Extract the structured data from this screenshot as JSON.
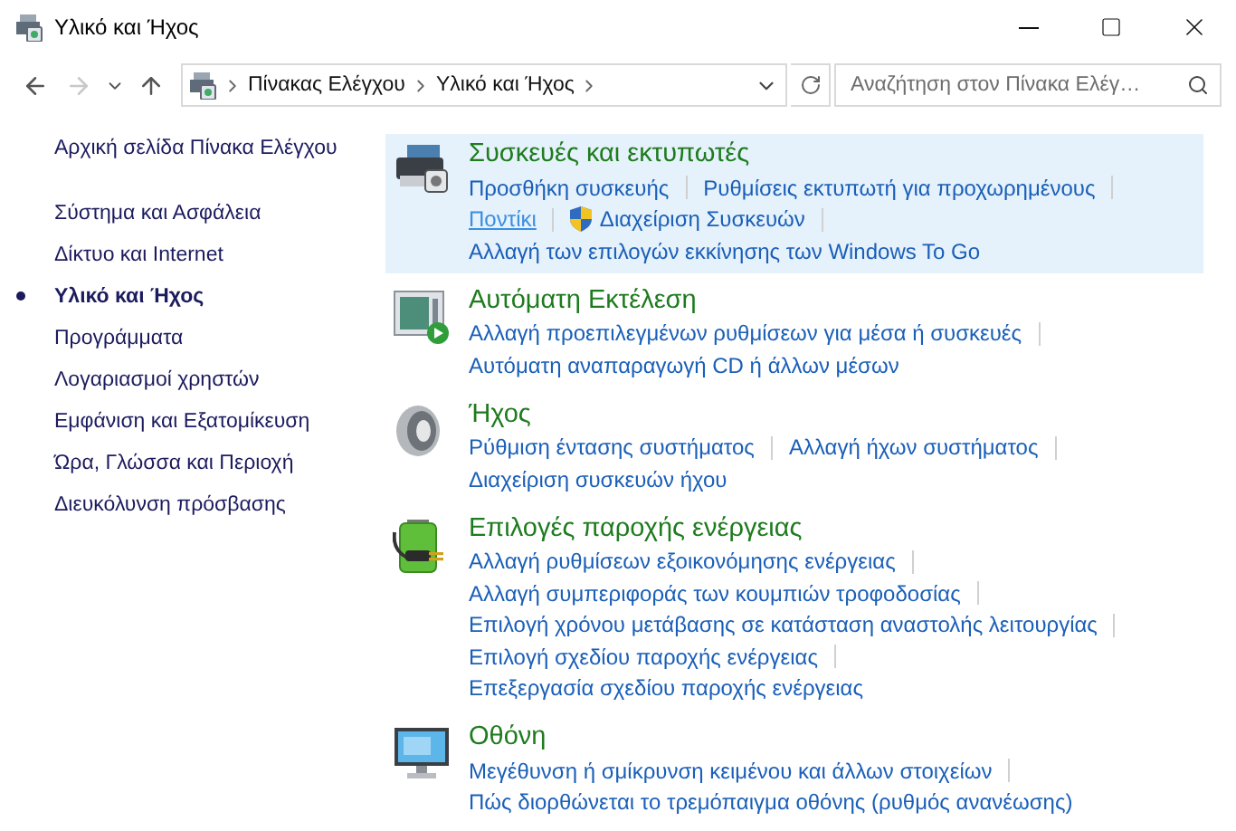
{
  "window": {
    "title": "Υλικό και Ήχος"
  },
  "navigation": {
    "back": {
      "disabled": false
    },
    "forward": {
      "disabled": true
    }
  },
  "address_bar": {
    "path": [
      "Πίνακας Ελέγχου",
      "Υλικό και Ήχος"
    ]
  },
  "search": {
    "placeholder": "Αναζήτηση στον Πίνακα Ελέγ…"
  },
  "sidebar": {
    "home": "Αρχική σελίδα Πίνακα Ελέγχου",
    "items": [
      {
        "label": "Σύστημα και Ασφάλεια",
        "selected": false
      },
      {
        "label": "Δίκτυο και Internet",
        "selected": false
      },
      {
        "label": "Υλικό και Ήχος",
        "selected": true
      },
      {
        "label": "Προγράμματα",
        "selected": false
      },
      {
        "label": "Λογαριασμοί χρηστών",
        "selected": false
      },
      {
        "label": "Εμφάνιση και Εξατομίκευση",
        "selected": false
      },
      {
        "label": "Ώρα, Γλώσσα και Περιοχή",
        "selected": false
      },
      {
        "label": "Διευκόλυνση πρόσβασης",
        "selected": false
      }
    ]
  },
  "categories": [
    {
      "kind": "printer",
      "title": "Συσκευές και εκτυπωτές",
      "highlighted": true,
      "link_rows": [
        [
          {
            "label": "Προσθήκη συσκευής"
          },
          {
            "label": "Ρυθμίσεις εκτυπωτή για προχωρημένους"
          }
        ],
        [
          {
            "label": "Ποντίκι",
            "hovered": true
          },
          {
            "label": "Διαχείριση Συσκευών",
            "shield": true
          }
        ],
        [
          {
            "label": "Αλλαγή των επιλογών εκκίνησης των Windows To Go"
          }
        ]
      ]
    },
    {
      "kind": "autoplay",
      "title": "Αυτόματη Εκτέλεση",
      "highlighted": false,
      "link_rows": [
        [
          {
            "label": "Αλλαγή προεπιλεγμένων ρυθμίσεων για μέσα ή συσκευές"
          }
        ],
        [
          {
            "label": "Αυτόματη αναπαραγωγή CD ή άλλων μέσων"
          }
        ]
      ]
    },
    {
      "kind": "sound",
      "title": "Ήχος",
      "highlighted": false,
      "link_rows": [
        [
          {
            "label": "Ρύθμιση έντασης συστήματος"
          },
          {
            "label": "Αλλαγή ήχων συστήματος"
          }
        ],
        [
          {
            "label": "Διαχείριση συσκευών ήχου"
          }
        ]
      ]
    },
    {
      "kind": "power",
      "title": "Επιλογές παροχής ενέργειας",
      "highlighted": false,
      "link_rows": [
        [
          {
            "label": "Αλλαγή ρυθμίσεων εξοικονόμησης ενέργειας"
          }
        ],
        [
          {
            "label": "Αλλαγή συμπεριφοράς των κουμπιών τροφοδοσίας"
          }
        ],
        [
          {
            "label": "Επιλογή χρόνου μετάβασης σε κατάσταση αναστολής λειτουργίας"
          }
        ],
        [
          {
            "label": "Επιλογή σχεδίου παροχής ενέργειας"
          }
        ],
        [
          {
            "label": "Επεξεργασία σχεδίου παροχής ενέργειας"
          }
        ]
      ]
    },
    {
      "kind": "display",
      "title": "Οθόνη",
      "highlighted": false,
      "link_rows": [
        [
          {
            "label": "Μεγέθυνση ή σμίκρυνση κειμένου και άλλων στοιχείων"
          }
        ],
        [
          {
            "label": "Πώς διορθώνεται το τρεμόπαιγμα οθόνης (ρυθμός ανανέωσης)"
          }
        ]
      ]
    }
  ]
}
